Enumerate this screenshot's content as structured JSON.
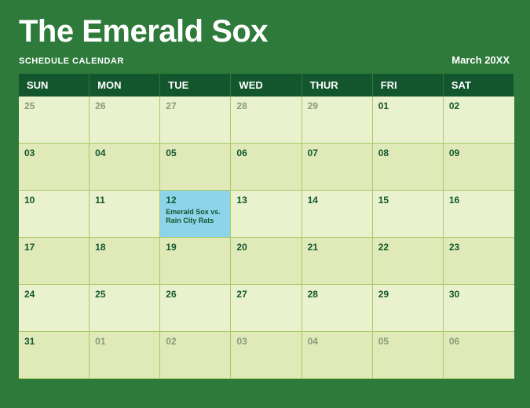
{
  "title": "The Emerald Sox",
  "subtitle": "SCHEDULE CALENDAR",
  "month_label": "March  20XX",
  "day_labels": [
    "SUN",
    "MON",
    "TUE",
    "WED",
    "THUR",
    "FRI",
    "SAT"
  ],
  "weeks": [
    [
      {
        "num": "25",
        "outside": true
      },
      {
        "num": "26",
        "outside": true
      },
      {
        "num": "27",
        "outside": true
      },
      {
        "num": "28",
        "outside": true
      },
      {
        "num": "29",
        "outside": true
      },
      {
        "num": "01",
        "outside": false
      },
      {
        "num": "02",
        "outside": false
      }
    ],
    [
      {
        "num": "03"
      },
      {
        "num": "04"
      },
      {
        "num": "05"
      },
      {
        "num": "06"
      },
      {
        "num": "07"
      },
      {
        "num": "08"
      },
      {
        "num": "09"
      }
    ],
    [
      {
        "num": "10"
      },
      {
        "num": "11"
      },
      {
        "num": "12",
        "event": "Emerald Sox vs. Rain City Rats"
      },
      {
        "num": "13"
      },
      {
        "num": "14"
      },
      {
        "num": "15"
      },
      {
        "num": "16"
      }
    ],
    [
      {
        "num": "17"
      },
      {
        "num": "18"
      },
      {
        "num": "19"
      },
      {
        "num": "20"
      },
      {
        "num": "21"
      },
      {
        "num": "22"
      },
      {
        "num": "23"
      }
    ],
    [
      {
        "num": "24"
      },
      {
        "num": "25"
      },
      {
        "num": "26"
      },
      {
        "num": "27"
      },
      {
        "num": "28"
      },
      {
        "num": "29"
      },
      {
        "num": "30"
      }
    ],
    [
      {
        "num": "31"
      },
      {
        "num": "01",
        "outside": true
      },
      {
        "num": "02",
        "outside": true
      },
      {
        "num": "03",
        "outside": true
      },
      {
        "num": "04",
        "outside": true
      },
      {
        "num": "05",
        "outside": true
      },
      {
        "num": "06",
        "outside": true
      }
    ]
  ]
}
